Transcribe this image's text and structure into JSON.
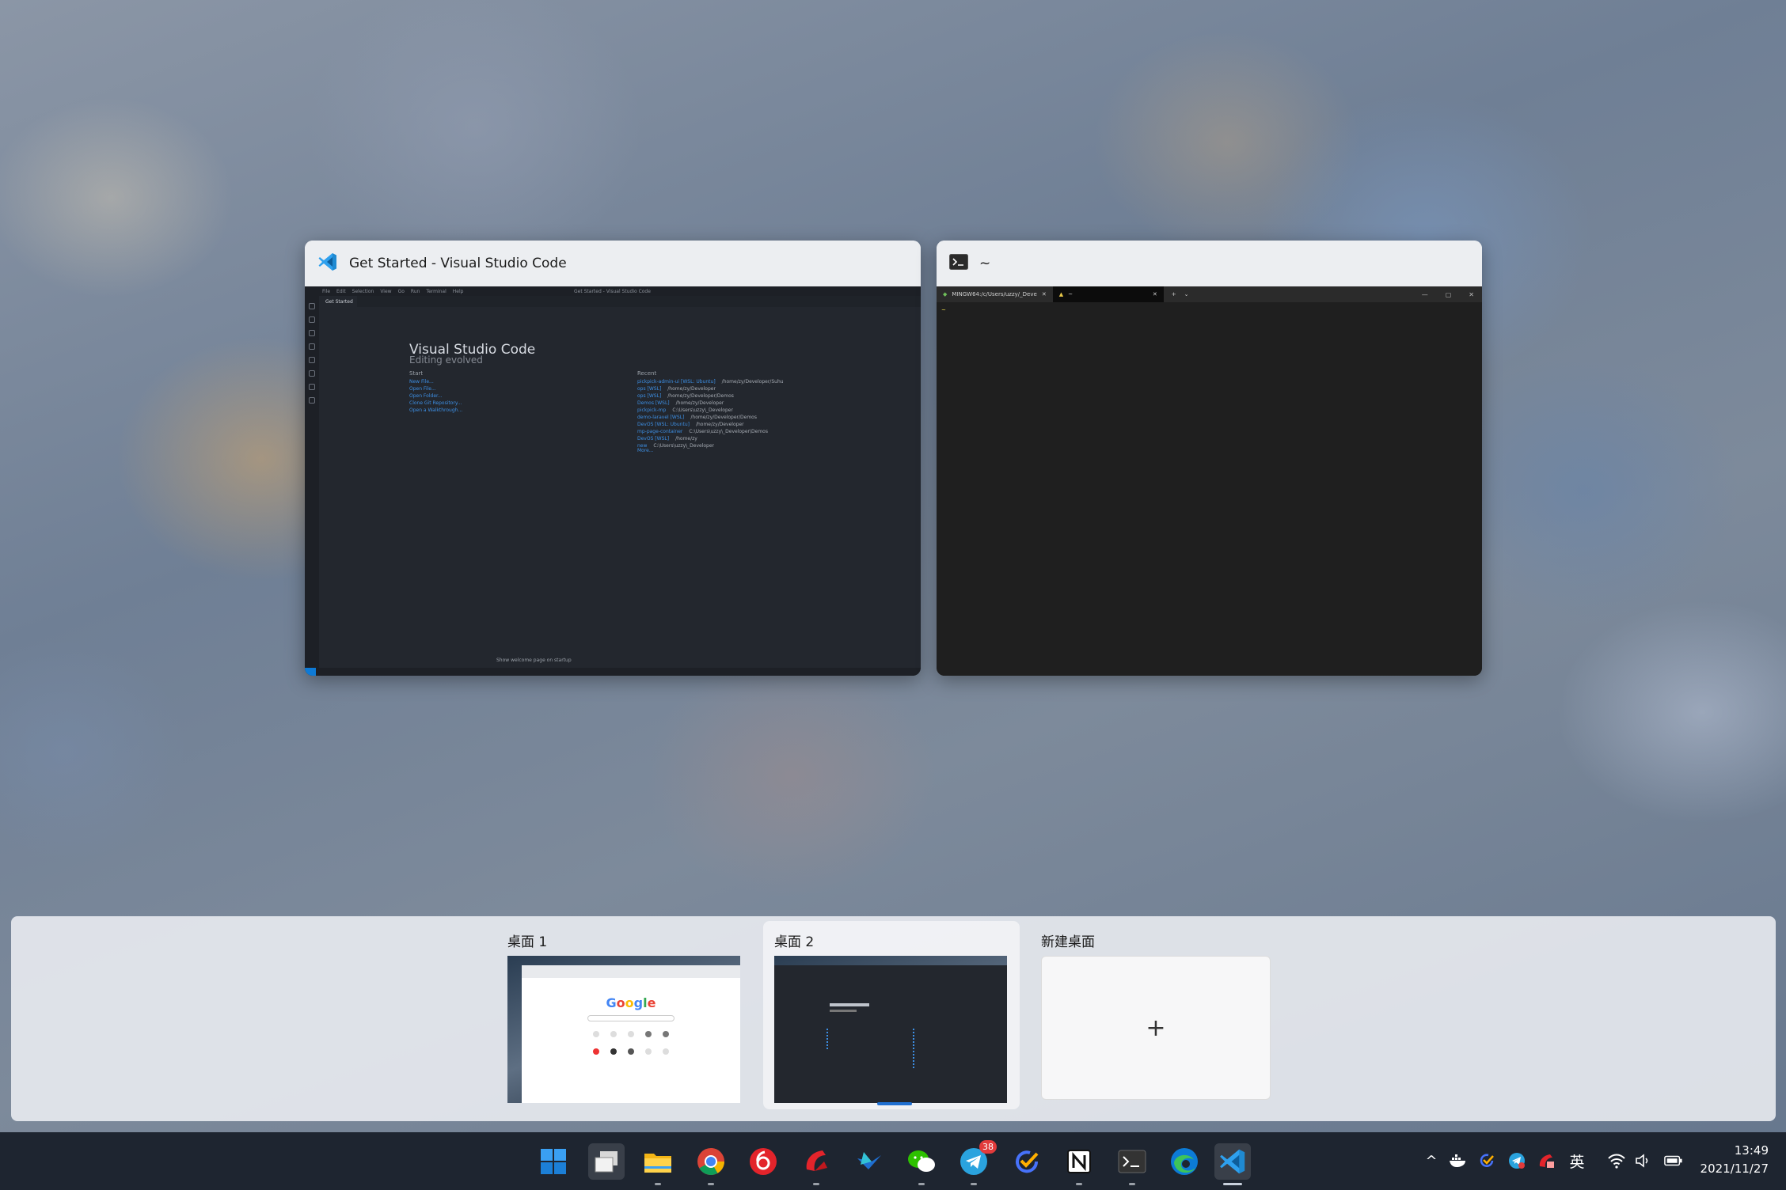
{
  "windows": {
    "vscode": {
      "title": "Get Started - Visual Studio Code",
      "menu": [
        "File",
        "Edit",
        "Selection",
        "View",
        "Go",
        "Run",
        "Terminal",
        "Help"
      ],
      "inner_title": "Get Started - Visual Studio Code",
      "tab": "Get Started",
      "heading": "Visual Studio Code",
      "subheading": "Editing evolved",
      "start_label": "Start",
      "start_items": [
        "New File...",
        "Open File...",
        "Open Folder...",
        "Clone Git Repository...",
        "Open a Walkthrough..."
      ],
      "recent_label": "Recent",
      "recent": [
        {
          "name": "pickpick-admin-ui [WSL: Ubuntu]",
          "path": "/home/zy/Developer/Suhu"
        },
        {
          "name": "ops [WSL]",
          "path": "/home/zy/Developer"
        },
        {
          "name": "ops [WSL]",
          "path": "/home/zy/Developer/Demos"
        },
        {
          "name": "Demos [WSL]",
          "path": "/home/zy/Developer"
        },
        {
          "name": "pickpick-mp",
          "path": "C:\\Users\\uzzy\\_Developer"
        },
        {
          "name": "demo-laravel [WSL]",
          "path": "/home/zy/Developer/Demos"
        },
        {
          "name": "DevOS [WSL: Ubuntu]",
          "path": "/home/zy/Developer"
        },
        {
          "name": "mp-page-container",
          "path": "C:\\Users\\uzzy\\_Developer\\Demos"
        },
        {
          "name": "DevOS [WSL]",
          "path": "/home/zy"
        },
        {
          "name": "new",
          "path": "C:\\Users\\uzzy\\_Developer"
        }
      ],
      "more_label": "More...",
      "footer": "Show welcome page on startup"
    },
    "terminal": {
      "title": "~",
      "tab1": "MINGW64:/c/Users/uzzy/_Deve",
      "tab2": "~",
      "prompt": "~"
    }
  },
  "desktops": {
    "items": [
      {
        "label": "桌面 1"
      },
      {
        "label": "桌面 2"
      }
    ],
    "new_label": "新建桌面",
    "new_plus": "+"
  },
  "taskbar": {
    "telegram_badge": "38",
    "tray_ime": "英",
    "time": "13:49",
    "date": "2021/11/27"
  }
}
